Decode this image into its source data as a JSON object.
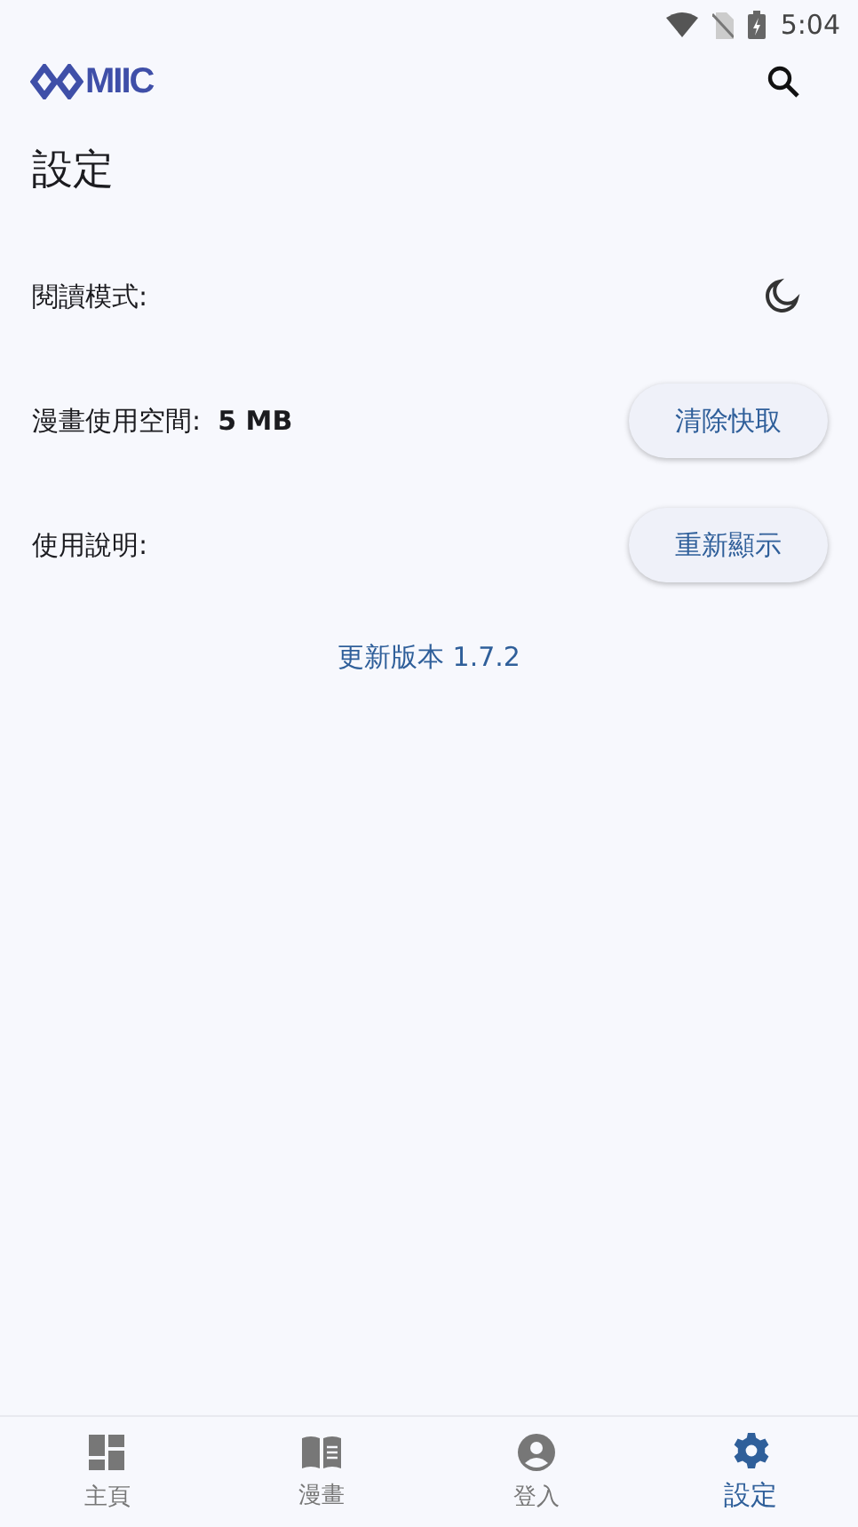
{
  "status_bar": {
    "time": "5:04"
  },
  "app_bar": {
    "logo_text": "MIIC"
  },
  "page_title": "設定",
  "settings": [
    {
      "kind": "icon",
      "label": "閱讀模式:"
    },
    {
      "kind": "button",
      "label": "漫畫使用空間:",
      "value": "5 MB",
      "button": "清除快取"
    },
    {
      "kind": "button",
      "label": "使用說明:",
      "button": "重新顯示"
    }
  ],
  "update_link": "更新版本 1.7.2",
  "bottom_nav": [
    {
      "label": "主頁",
      "kind": "dashboard",
      "selected": false
    },
    {
      "label": "漫畫",
      "kind": "book",
      "selected": false
    },
    {
      "label": "登入",
      "kind": "account",
      "selected": false
    },
    {
      "label": "設定",
      "kind": "settings",
      "selected": true
    }
  ]
}
